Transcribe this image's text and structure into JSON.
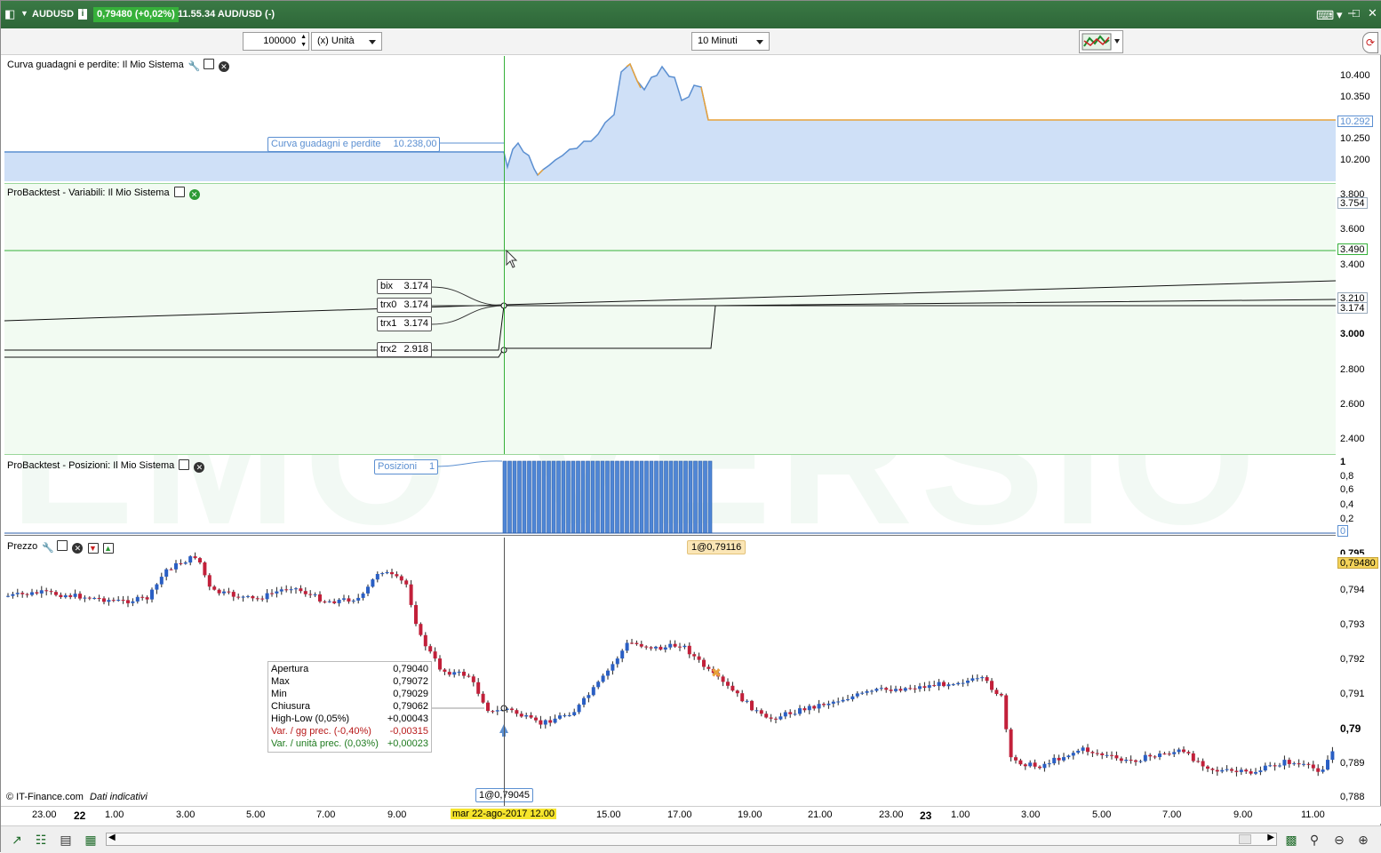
{
  "title": {
    "symbol": "AUDUSD",
    "quote": "0,79480 (+0,02%)",
    "time_line": "11.55.34 AUD/USD (-)"
  },
  "toolbar": {
    "quantity": "100000",
    "unit": "(x) Unità",
    "timeframe": "10 Minuti"
  },
  "equity_panel": {
    "label": "Curva guadagni e perdite: Il Mio Sistema",
    "tooltip_name": "Curva guadagni e perdite",
    "tooltip_value": "10.238,00",
    "axis": [
      "10.400",
      "10.350",
      "10.250",
      "10.200"
    ],
    "last_tag": "10.292",
    "color_line": "#5b8fd1",
    "color_fill": "#cfe0f7",
    "color_after": "#e8a23a"
  },
  "vars_panel": {
    "label": "ProBacktest - Variabili: Il Mio Sistema",
    "axis": [
      "3.800",
      "3.600",
      "3.400",
      "3.000",
      "2.800",
      "2.600",
      "2.400"
    ],
    "tags": [
      "3.754",
      "3.490",
      "3.210",
      "3.174"
    ],
    "series": [
      {
        "name": "bix",
        "value": "3.174"
      },
      {
        "name": "trx0",
        "value": "3.174"
      },
      {
        "name": "trx1",
        "value": "3.174"
      },
      {
        "name": "trx2",
        "value": "2.918"
      }
    ]
  },
  "pos_panel": {
    "label": "ProBacktest - Posizioni: Il Mio Sistema",
    "tooltip_name": "Posizioni",
    "tooltip_value": "1",
    "axis": [
      "1",
      "0,8",
      "0,6",
      "0,4",
      "0,2",
      "0"
    ]
  },
  "price_panel": {
    "label": "Prezzo",
    "axis": [
      "0,794",
      "0,793",
      "0,792",
      "0,791",
      "0,79",
      "0,789",
      "0,788"
    ],
    "axis_top": "0,795",
    "last_tag": "0,79480",
    "exit_label": "1@0,79116",
    "entry_label": "1@0,79045",
    "ohlc": [
      {
        "k": "Apertura",
        "v": "0,79040",
        "c": "#000000"
      },
      {
        "k": "Max",
        "v": "0,79072",
        "c": "#000000"
      },
      {
        "k": "Min",
        "v": "0,79029",
        "c": "#000000"
      },
      {
        "k": "Chiusura",
        "v": "0,79062",
        "c": "#000000"
      },
      {
        "k": "High-Low (0,05%)",
        "v": "+0,00043",
        "c": "#000000"
      },
      {
        "k": "Var. / gg prec. (-0,40%)",
        "v": "-0,00315",
        "c": "#b81a1a"
      },
      {
        "k": "Var. / unità prec. (0,03%)",
        "v": "+0,00023",
        "c": "#1e7a1e"
      }
    ],
    "credit": "© IT-Finance.com",
    "credit_note": "Dati indicativi",
    "watermark": "EMO VERSIO"
  },
  "time_axis": {
    "labels": [
      {
        "t": "23.00",
        "b": false
      },
      {
        "t": "22",
        "b": true
      },
      {
        "t": "1.00",
        "b": false
      },
      {
        "t": "3.00",
        "b": false
      },
      {
        "t": "5.00",
        "b": false
      },
      {
        "t": "7.00",
        "b": false
      },
      {
        "t": "9.00",
        "b": false
      },
      {
        "t": "15.00",
        "b": false
      },
      {
        "t": "17.00",
        "b": false
      },
      {
        "t": "19.00",
        "b": false
      },
      {
        "t": "21.00",
        "b": false
      },
      {
        "t": "23.00",
        "b": false
      },
      {
        "t": "23",
        "b": true
      },
      {
        "t": "1.00",
        "b": false
      },
      {
        "t": "3.00",
        "b": false
      },
      {
        "t": "5.00",
        "b": false
      },
      {
        "t": "7.00",
        "b": false
      },
      {
        "t": "9.00",
        "b": false
      },
      {
        "t": "11.00",
        "b": false
      }
    ],
    "cursor_label": "mar 22-ago-2017 12.00"
  }
}
